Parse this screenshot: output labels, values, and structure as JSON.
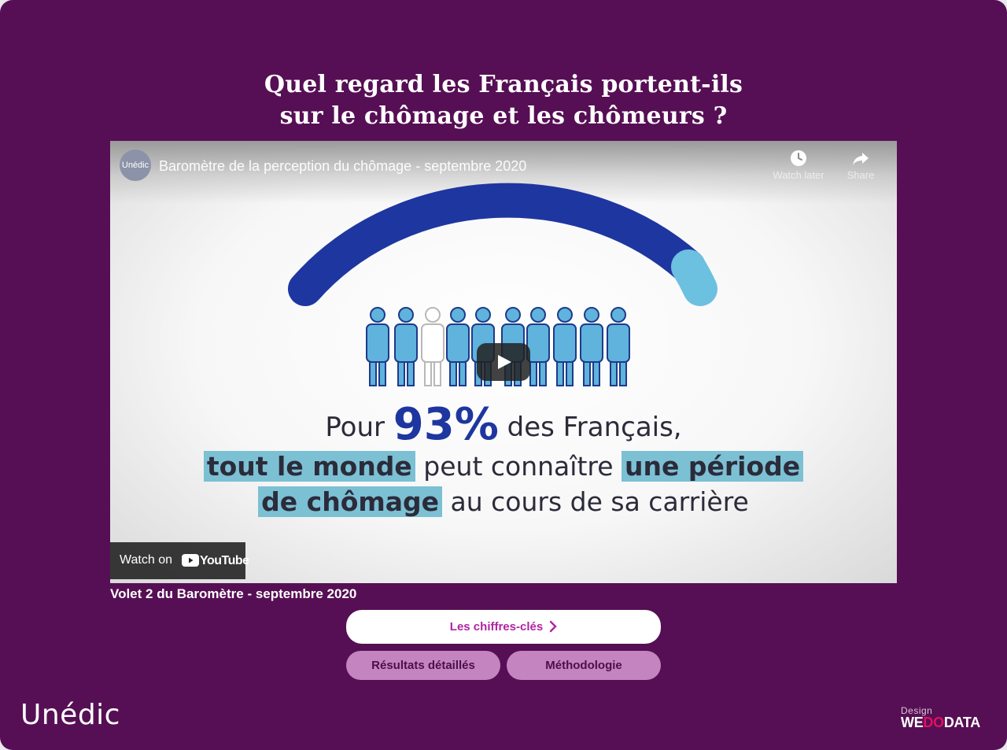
{
  "title": {
    "line1": "Quel regard les Français portent-ils",
    "line2": "sur le chômage et les chômeurs ?"
  },
  "video": {
    "channel_badge": "Unédic",
    "title": "Baromètre de la perception du chômage - septembre 2020",
    "watch_later_label": "Watch later",
    "share_label": "Share",
    "frame_text": {
      "pour": "Pour",
      "percent": "93%",
      "des_francais": "des Français,",
      "hl1": "tout le monde",
      "mid": "peut connaître",
      "hl2": "une période",
      "hl3": "de chômage",
      "end": "au cours de sa carrière"
    },
    "stat_value_percent": 93,
    "watch_on_label": "Watch on",
    "youtube_label": "YouTube"
  },
  "caption": "Volet 2 du Baromètre - septembre 2020",
  "buttons": {
    "primary": "Les chiffres-clés",
    "results": "Résultats détaillés",
    "methodology": "Méthodologie"
  },
  "footer": {
    "brand": "Unédic",
    "design_label": "Design",
    "credit_we": "WE",
    "credit_do": "DO",
    "credit_data": "DATA"
  },
  "colors": {
    "background": "#560f54",
    "accent": "#b024a2",
    "secondary_button": "#c484bf",
    "arc_dark": "#1e36a0",
    "arc_light": "#6cc0e0"
  }
}
